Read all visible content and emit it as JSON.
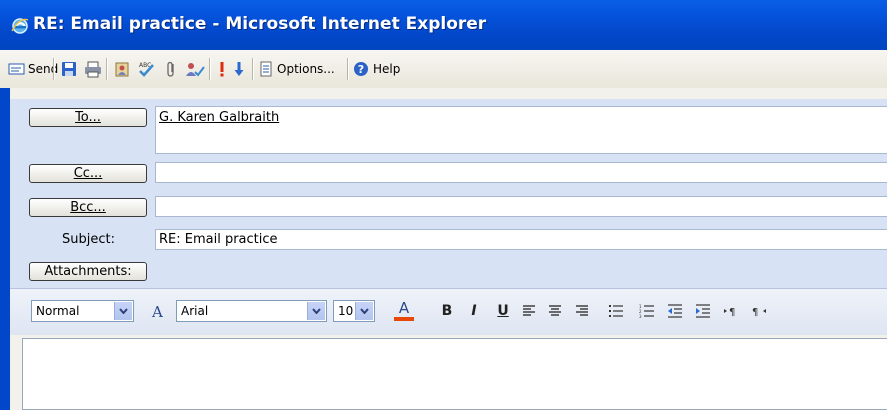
{
  "window": {
    "title": "RE: Email practice - Microsoft Internet Explorer"
  },
  "toolbar": {
    "send_label": "Send",
    "options_label": "Options...",
    "help_label": "Help"
  },
  "header": {
    "to_button": "To...",
    "to_value": "G. Karen Galbraith",
    "cc_button": "Cc...",
    "cc_value": "",
    "bcc_button": "Bcc...",
    "bcc_value": "",
    "subject_label": "Subject:",
    "subject_value": "RE: Email practice",
    "attachments_button": "Attachments:"
  },
  "format": {
    "style": "Normal",
    "font": "Arial",
    "size": "10",
    "font_color_glyph": "A",
    "bold": "B",
    "italic": "I",
    "underline": "U"
  },
  "colors": {
    "title_bar": "#0046c0",
    "header_bg": "#d7e3f5",
    "font_color_underline": "#e8470a"
  }
}
